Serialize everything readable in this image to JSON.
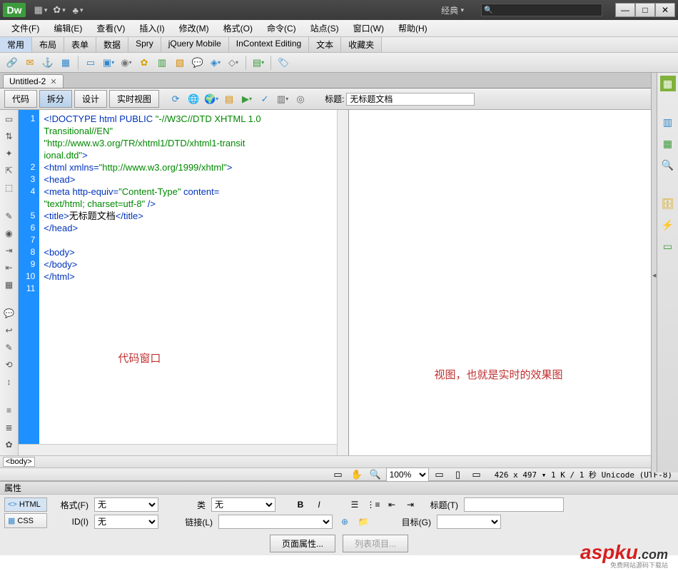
{
  "app": {
    "logo": "Dw"
  },
  "workspace": {
    "label": "经典"
  },
  "search": {
    "placeholder": ""
  },
  "window_buttons": {
    "min": "—",
    "max": "□",
    "close": "✕"
  },
  "menubar": [
    "文件(F)",
    "编辑(E)",
    "查看(V)",
    "插入(I)",
    "修改(M)",
    "格式(O)",
    "命令(C)",
    "站点(S)",
    "窗口(W)",
    "帮助(H)"
  ],
  "insert_categories": [
    "常用",
    "布局",
    "表单",
    "数据",
    "Spry",
    "jQuery Mobile",
    "InContext Editing",
    "文本",
    "收藏夹"
  ],
  "document": {
    "tab_name": "Untitled-2",
    "title_label": "标题:",
    "title_value": "无标题文档"
  },
  "view_modes": {
    "code": "代码",
    "split": "拆分",
    "design": "设计",
    "live": "实时视图"
  },
  "code": {
    "lines": [
      1,
      2,
      3,
      4,
      5,
      6,
      7,
      8,
      9,
      10,
      11
    ],
    "content": "<!DOCTYPE html PUBLIC \"-//W3C//DTD XHTML 1.0\nTransitional//EN\"\n\"http://www.w3.org/TR/xhtml1/DTD/xhtml1-transit\nional.dtd\">\n<html xmlns=\"http://www.w3.org/1999/xhtml\">\n<head>\n<meta http-equiv=\"Content-Type\" content=\n\"text/html; charset=utf-8\" />\n<title>无标题文档</title>\n</head>\n\n<body>\n</body>\n</html>"
  },
  "annotations": {
    "code_pane": "代码窗口",
    "design_pane": "视图，也就是实时的效果图"
  },
  "tag_selector": "<body>",
  "statusbar": {
    "zoom": "100%",
    "info": "426 x 497 ▾ 1 K / 1 秒 Unicode (UTF-8)"
  },
  "properties": {
    "title": "属性",
    "tab_html": "HTML",
    "tab_css": "CSS",
    "format_label": "格式(F)",
    "format_value": "无",
    "id_label": "ID(I)",
    "id_value": "无",
    "class_label": "类",
    "class_value": "无",
    "link_label": "链接(L)",
    "title_label": "标题(T)",
    "target_label": "目标(G)",
    "page_props_btn": "页面属性...",
    "list_item_btn": "列表项目..."
  },
  "watermark": {
    "main": "aspku",
    "suffix": ".com",
    "sub": "免费网站源码下载站"
  }
}
